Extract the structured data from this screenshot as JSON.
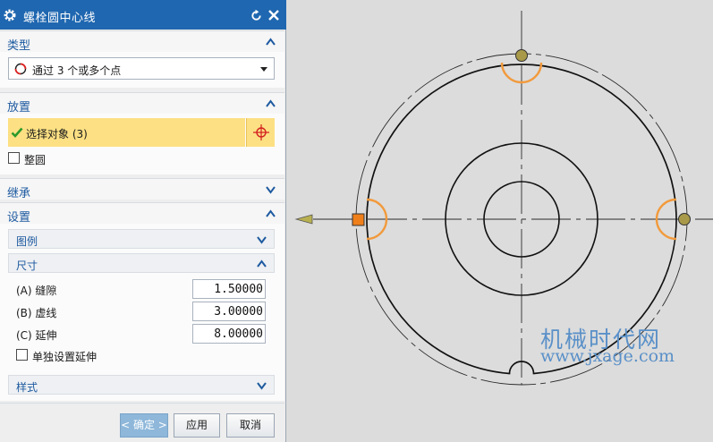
{
  "dialog": {
    "title": "螺栓圆中心线",
    "sections": {
      "type": {
        "label": "类型",
        "selected": "通过 3 个或多个点"
      },
      "placement": {
        "label": "放置",
        "select_object": "选择对象 (3)",
        "full_circle": "整圆"
      },
      "inherit": {
        "label": "继承"
      },
      "settings": {
        "label": "设置",
        "legend": "图例",
        "size": "尺寸",
        "fields": [
          {
            "label": "(A) 缝隙",
            "value": "1.50000"
          },
          {
            "label": "(B) 虚线",
            "value": "3.00000"
          },
          {
            "label": "(C) 延伸",
            "value": "8.00000"
          }
        ],
        "separate_extension": "单独设置延伸",
        "style": "样式"
      }
    },
    "buttons": {
      "ok": "< 确定 >",
      "apply": "应用",
      "cancel": "取消"
    }
  },
  "watermark": {
    "line1": "机械时代网",
    "line2": "www.jxage.com"
  },
  "colors": {
    "title_bar": "#1f67b0",
    "section_label": "#1e5aa0",
    "highlight": "#fce083",
    "marker_orange": "#f29a3c",
    "point_olive": "#a99a4a",
    "watermark": "#5a90c8"
  },
  "icons": [
    "gear-icon",
    "reset-icon",
    "close-icon",
    "chevron-up-icon",
    "chevron-down-icon",
    "circle-type-icon",
    "dropdown-arrow-icon",
    "checkmark-icon",
    "crosshair-icon"
  ]
}
